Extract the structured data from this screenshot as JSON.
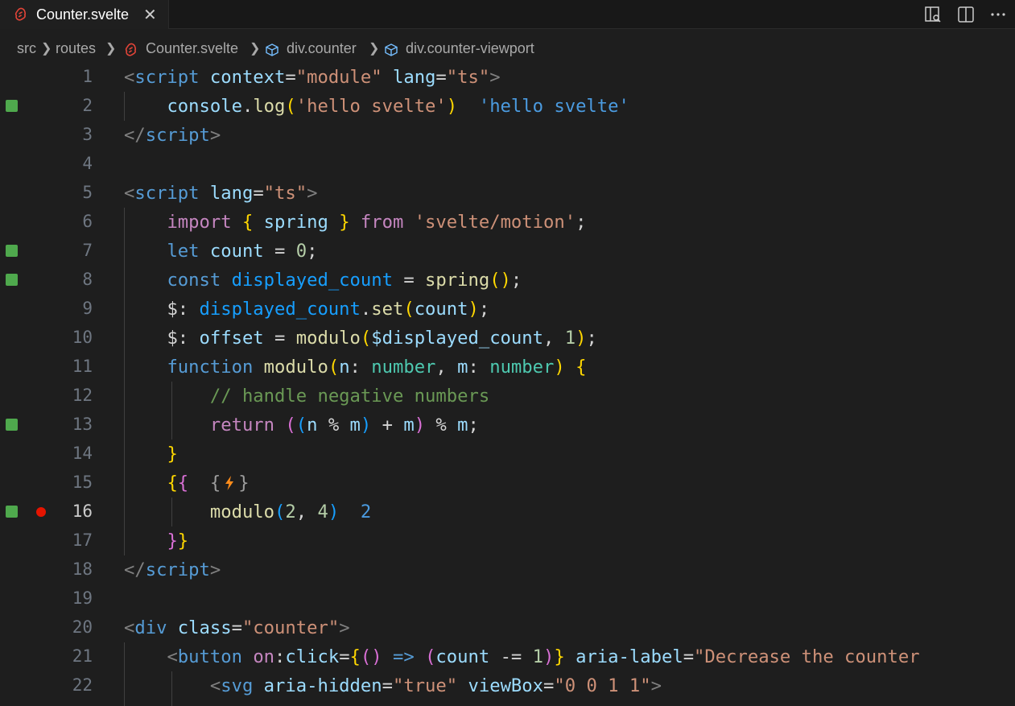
{
  "tab": {
    "title": "Counter.svelte",
    "close_symbol": "✕",
    "icon": "svelte-icon",
    "actions": [
      "open-preview-icon",
      "split-editor-icon",
      "more-actions-icon"
    ]
  },
  "breadcrumb": {
    "items": [
      "src",
      "routes",
      "Counter.svelte",
      "div.counter",
      "div.counter-viewport"
    ]
  },
  "editor": {
    "lines": [
      {
        "n": "1"
      },
      {
        "n": "2"
      },
      {
        "n": "3"
      },
      {
        "n": "4"
      },
      {
        "n": "5"
      },
      {
        "n": "6"
      },
      {
        "n": "7"
      },
      {
        "n": "8"
      },
      {
        "n": "9"
      },
      {
        "n": "10"
      },
      {
        "n": "11"
      },
      {
        "n": "12"
      },
      {
        "n": "13"
      },
      {
        "n": "14"
      },
      {
        "n": "15"
      },
      {
        "n": "16"
      },
      {
        "n": "17"
      },
      {
        "n": "18"
      },
      {
        "n": "19"
      },
      {
        "n": "20"
      },
      {
        "n": "21"
      },
      {
        "n": "22"
      }
    ],
    "inline_results": {
      "line2": "'hello svelte'",
      "line16": "2"
    },
    "text": {
      "script_open_1": "script",
      "context_attr": "context",
      "context_val": "\"module\"",
      "lang_attr": "lang",
      "lang_val": "\"ts\"",
      "console": "console",
      "log": "log",
      "hello_str": "'hello svelte'",
      "script_close": "script",
      "import_kw": "import",
      "spring": "spring",
      "from_kw": "from",
      "motion_str": "'svelte/motion'",
      "let_kw": "let",
      "count": "count",
      "zero": "0",
      "const_kw": "const",
      "displayed_count": "displayed_count",
      "spring_fn": "spring",
      "dollar_label": "$",
      "set_fn": "set",
      "offset": "offset",
      "modulo": "modulo",
      "dollar_displayed": "$displayed_count",
      "one": "1",
      "function_kw": "function",
      "n": "n",
      "m": "m",
      "number_type": "number",
      "comment": "// handle negative numbers",
      "return_kw": "return",
      "two": "2",
      "four": "4",
      "div_tag": "div",
      "class_attr": "class",
      "counter_str": "\"counter\"",
      "button_tag": "button",
      "on_kw": "on",
      "click": "click",
      "minus_eq": "-=",
      "aria_label_attr": "aria-label",
      "aria_label_val": "\"Decrease the counter",
      "svg_tag": "svg",
      "aria_hidden_attr": "aria-hidden",
      "true_str": "\"true\"",
      "viewbox_attr": "viewBox",
      "viewbox_val": "\"0 0 1 1\""
    }
  },
  "colors": {
    "editor_bg": "#1e1e1e",
    "gutter_change": "#4fa94d",
    "breakpoint": "#e51400",
    "svelte_brand": "#ff3e00"
  }
}
